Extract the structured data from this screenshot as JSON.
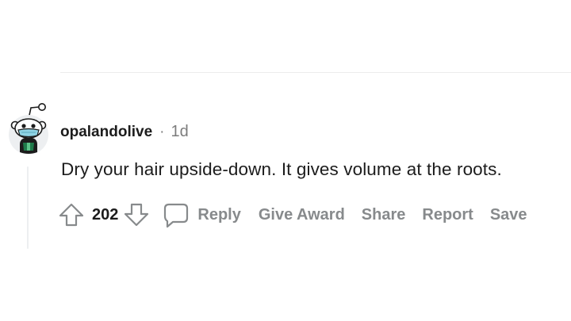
{
  "comment": {
    "username": "opalandolive",
    "separator": "·",
    "age": "1d",
    "body": "Dry your hair upside-down. It gives volume at the roots.",
    "avatar_icon": "snoo-avatar-icon"
  },
  "actions": {
    "score": "202",
    "upvote_icon": "upvote-arrow-icon",
    "downvote_icon": "downvote-arrow-icon",
    "comment_icon": "speech-bubble-icon",
    "reply_label": "Reply",
    "give_award_label": "Give Award",
    "share_label": "Share",
    "report_label": "Report",
    "save_label": "Save"
  },
  "colors": {
    "text_primary": "#1c1c1c",
    "text_meta": "#7c7c7c",
    "action_gray": "#878a8c",
    "avatar_shirt": "#1f7a4a",
    "avatar_mask": "#8fd3e4"
  }
}
